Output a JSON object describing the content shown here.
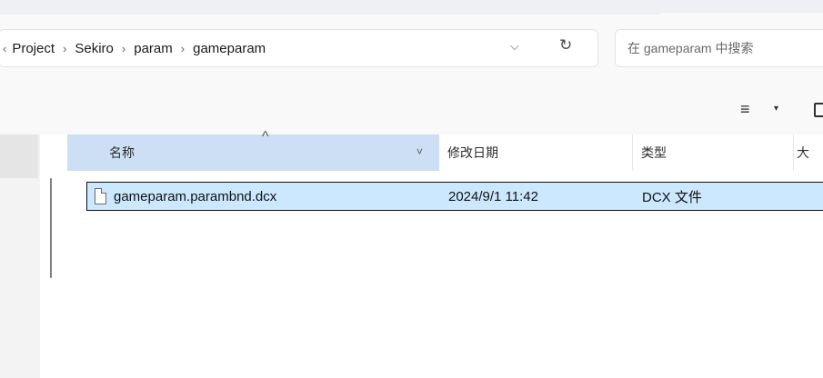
{
  "breadcrumb": {
    "leading_char": "‹",
    "items": [
      "Project",
      "Sekiro",
      "param",
      "gameparam"
    ],
    "separator": "›"
  },
  "address_icons": {
    "dropdown": "chevron-down-icon",
    "refresh": "refresh-icon"
  },
  "search": {
    "placeholder": "在 gameparam 中搜索"
  },
  "toolbar": {
    "view_icon": "≡",
    "view_caret": "▾"
  },
  "columns": {
    "name": "名称",
    "sort_caret": "^",
    "name_dropdown": "˅",
    "date": "修改日期",
    "type": "类型",
    "size": "大"
  },
  "files": [
    {
      "name": "gameparam.parambnd.dcx",
      "date": "2024/9/1 11:42",
      "type": "DCX 文件",
      "selected": true
    }
  ],
  "colors": {
    "selected_row": "#cce8ff",
    "header_highlight": "#ccdff4",
    "selection_border": "#0e0e0e"
  }
}
